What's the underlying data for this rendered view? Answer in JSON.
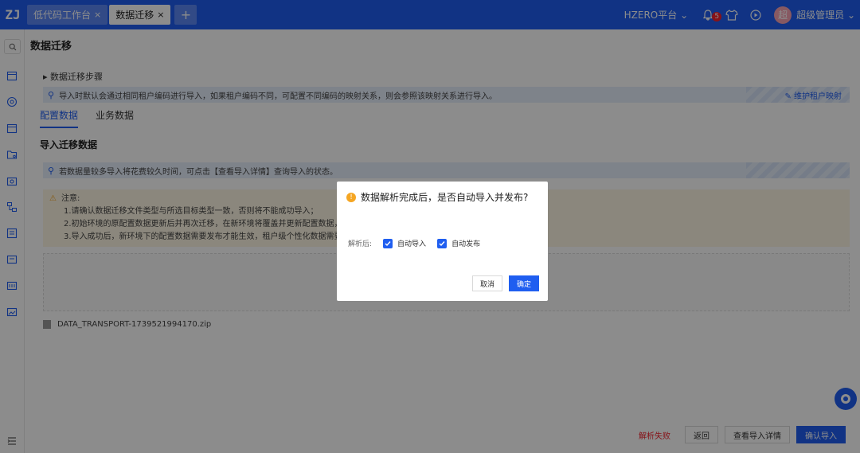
{
  "topbar": {
    "logo_text": "ZJ",
    "tabs": [
      {
        "label": "低代码工作台",
        "close": "×"
      },
      {
        "label": "数据迁移",
        "close": "×"
      }
    ],
    "add_tab": "+",
    "platform": "HZERO平台 ⌄",
    "notification_count": "5",
    "avatar_text": "超",
    "user_name": "超级管理员 ⌄"
  },
  "main": {
    "page_title": "数据迁移",
    "steps_label": "▸ 数据迁移步骤",
    "info1": "导入时默认会通过相同租户编码进行导入，如果租户编码不同，可配置不同编码的映射关系，则会参照该映射关系进行导入。",
    "maintain_link": "维护租户映射",
    "tabs": [
      "配置数据",
      "业务数据"
    ],
    "section_title": "导入迁移数据",
    "info2": "若数据量较多导入将花费较久时间，可点击【查看导入详情】查询导入的状态。",
    "warn_title": "注意:",
    "warn_items": [
      "1.请确认数据迁移文件类型与所选目标类型一致，否则将不能成功导入；",
      "2.初始环境的原配置数据更新后并再次迁移，在新环境将覆盖并更新配置数据，不会创建",
      "3.导入成功后，新环境下的配置数据需要发布才能生效，租户级个性化数据需要平台级数"
    ],
    "file_name": "DATA_TRANSPORT-1739521994170.zip",
    "error_text": "解析失败",
    "btn_back": "返回",
    "btn_detail": "查看导入详情",
    "btn_confirm": "确认导入"
  },
  "dialog": {
    "title": "数据解析完成后，是否自动导入并发布?",
    "after_label": "解析后:",
    "opt_import": "自动导入",
    "opt_publish": "自动发布",
    "cancel": "取消",
    "ok": "确定"
  }
}
